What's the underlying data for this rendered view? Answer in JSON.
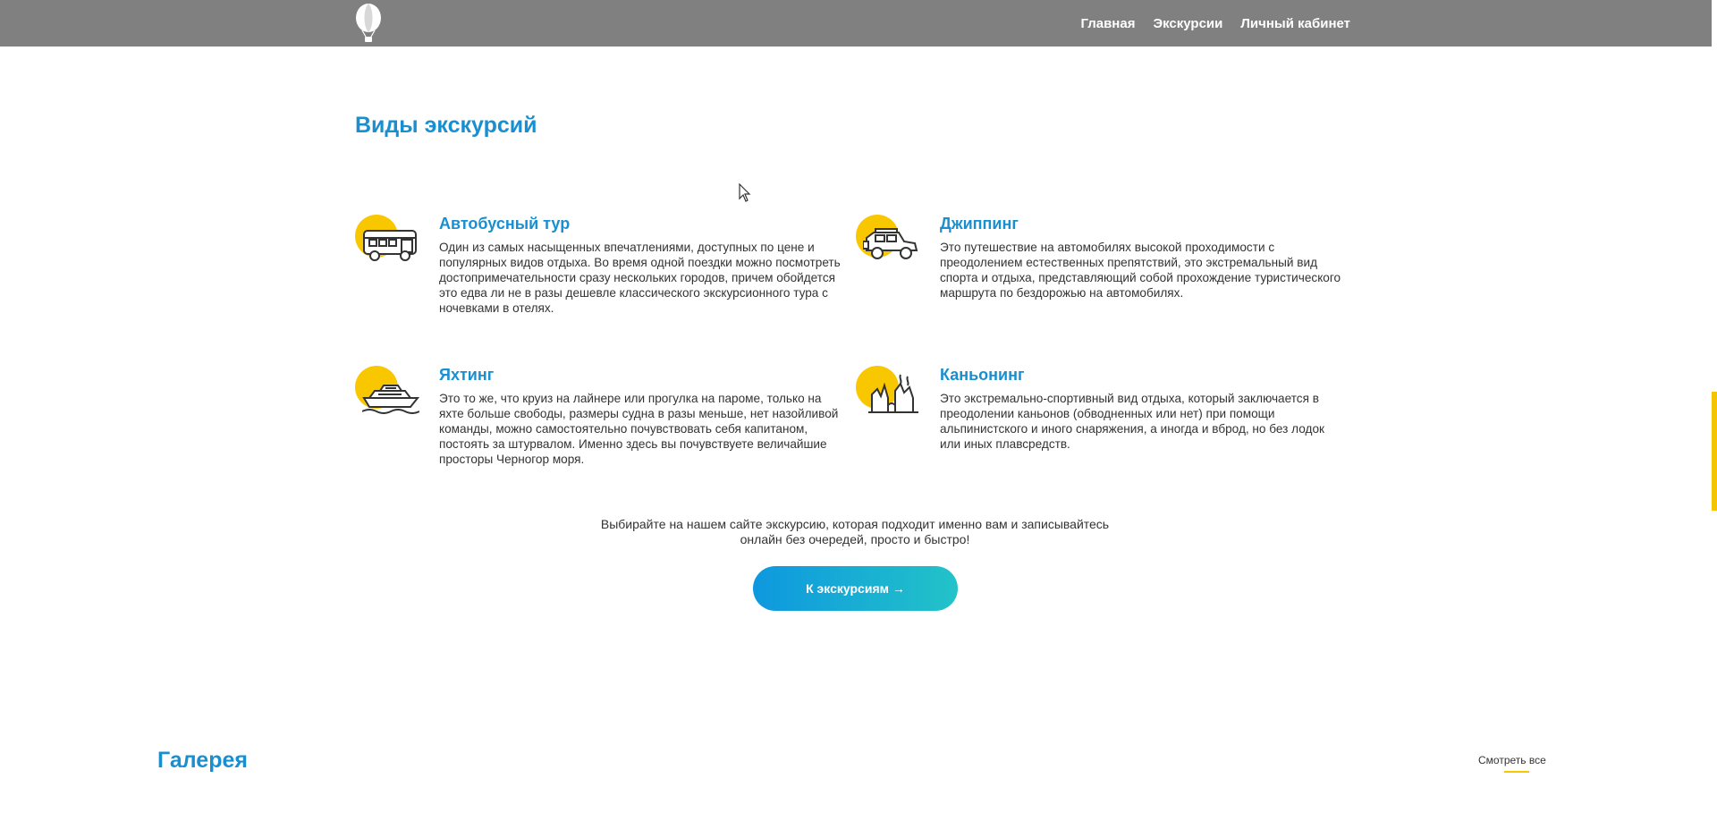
{
  "nav": {
    "logo_icon": "hot-air-balloon-icon",
    "items": [
      "Главная",
      "Экскурсии",
      "Личный кабинет"
    ]
  },
  "excursions": {
    "title": "Виды экскурсий",
    "items": [
      {
        "icon": "bus-icon",
        "title": "Автобусный тур",
        "text": "Один из самых насыщенных впечатлениями, доступных по цене и популярных видов отдыха. Во время одной поездки можно посмотреть достопримечательности сразу нескольких городов, причем обойдется это едва ли не в разы дешевле классического экскурсионного тура с ночевками в отелях."
      },
      {
        "icon": "jeep-icon",
        "title": "Джиппинг",
        "text": "Это путешествие на автомобилях высокой проходимости с преодолением естественных препятствий, это экстремальный вид спорта и отдыха, представляющий собой прохождение туристического маршрута по бездорожью на автомобилях."
      },
      {
        "icon": "yacht-icon",
        "title": "Яхтинг",
        "text": "Это то же, что круиз на лайнере или прогулка на пароме, только на яхте больше свободы, размеры судна в разы меньше, нет назойливой команды, можно самостоятельно почувствовать себя капитаном, постоять за штурвалом. Именно здесь вы почувствуете величайшие просторы Черногор моря."
      },
      {
        "icon": "canyon-icon",
        "title": "Каньонинг",
        "text": "Это экстремально-спортивный вид отдыха, который заключается в преодолении каньонов (обводненных или нет) при помощи альпинистского и иного снаряжения, а иногда и вброд, но без лодок или иных плавсредств."
      }
    ],
    "cta_text": "Выбирайте на нашем сайте экскурсию, которая подходит именно вам и записывайтесь онлайн без очередей, просто и быстро!",
    "cta_button": "К экскурсиям →"
  },
  "gallery": {
    "title": "Галерея",
    "see_all": "Смотреть все"
  },
  "colors": {
    "accent_blue": "#1a8fd0",
    "accent_yellow": "#f9c700",
    "header_bg": "#808080"
  }
}
